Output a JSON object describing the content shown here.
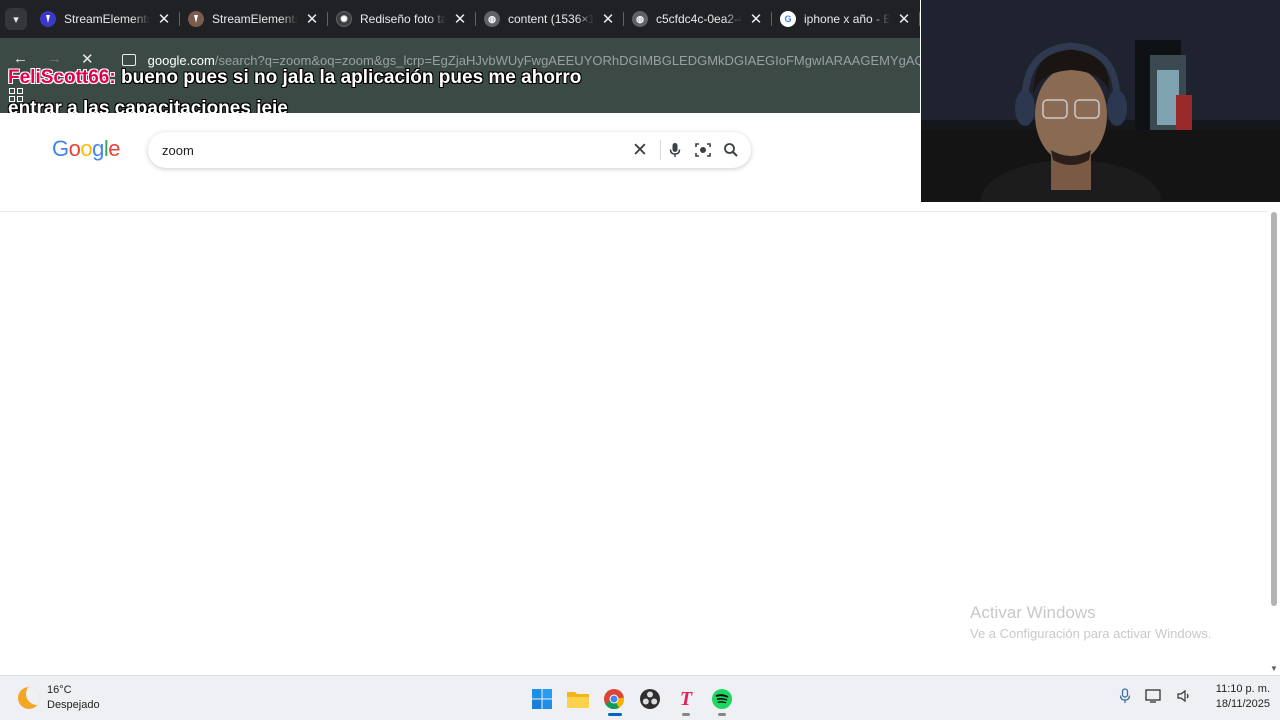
{
  "tabs": [
    {
      "title": "StreamElements",
      "icon": "streamelements-icon",
      "color": "#3a38c7"
    },
    {
      "title": "StreamElements",
      "icon": "streamelements-icon",
      "color": "#7a5c4e"
    },
    {
      "title": "Rediseño foto ta",
      "icon": "openai-icon",
      "color": "#3c4043"
    },
    {
      "title": "content (1536×1",
      "icon": "globe-icon",
      "color": "#5f6368"
    },
    {
      "title": "c5cfdc4c-0ea2-4",
      "icon": "globe-icon",
      "color": "#5f6368"
    },
    {
      "title": "iphone x año - B",
      "icon": "google-icon",
      "color": "#4285f4"
    }
  ],
  "toolbar": {
    "url_domain": "google.com",
    "url_path": "/search?q=zoom&oq=zoom&gs_lcrp=EgZjaHJvbWUyFwgAEEUYORhDGIMBGLEDGMkDGIAEGIoFMgwIARAAGEMYgAQYig"
  },
  "chat": {
    "username": "FeliScott66:",
    "message": " bueno pues si no jala la aplicación pues me ahorro entrar a las capacitaciones jeje",
    "username_color": "#e5004f"
  },
  "google": {
    "logo": "Google",
    "query": "zoom"
  },
  "watermark": {
    "title": "Activar Windows",
    "subtitle": "Ve a Configuración para activar Windows."
  },
  "taskbar": {
    "weather_temp": "16°C",
    "weather_condition": "Despejado",
    "apps": [
      "windows-start-icon",
      "file-explorer-icon",
      "chrome-icon",
      "obs-icon",
      "typora-icon",
      "spotify-icon"
    ],
    "time": "11:10 p. m.",
    "date": "18/11/2025"
  }
}
